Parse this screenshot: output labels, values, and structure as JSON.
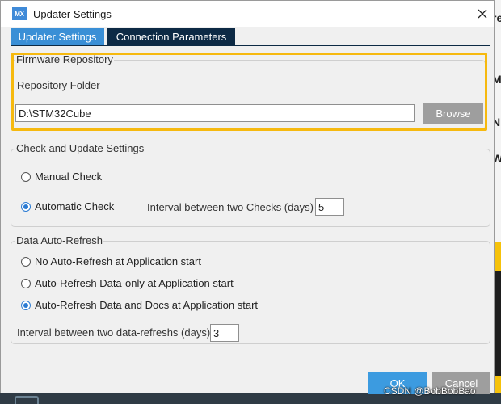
{
  "window": {
    "app_icon_text": "MX",
    "title": "Updater Settings",
    "close_glyph": "✕"
  },
  "tabs": [
    {
      "label": "Updater Settings",
      "active": true
    },
    {
      "label": "Connection Parameters",
      "active": false
    }
  ],
  "firmware_repository": {
    "legend": "Firmware Repository",
    "folder_label": "Repository Folder",
    "folder_value": "D:\\STM32Cube",
    "browse_label": "Browse",
    "highlight_color": "#f6b90f"
  },
  "check_update": {
    "legend": "Check and Update Settings",
    "manual_label": "Manual Check",
    "manual_checked": false,
    "automatic_label": "Automatic Check",
    "automatic_checked": true,
    "interval_label": "Interval between two Checks (days)",
    "interval_value": "5"
  },
  "data_refresh": {
    "legend": "Data Auto-Refresh",
    "options": [
      {
        "label": "No Auto-Refresh at Application start",
        "checked": false
      },
      {
        "label": "Auto-Refresh Data-only at Application start",
        "checked": false
      },
      {
        "label": "Auto-Refresh Data and Docs at Application start",
        "checked": true
      }
    ],
    "interval_label": "Interval between two data-refreshs (days)",
    "interval_value": "3"
  },
  "footer": {
    "ok_label": "OK",
    "cancel_label": "Cancel"
  },
  "background": {
    "glyphs": [
      "re",
      "M",
      "N",
      "W"
    ]
  },
  "watermark": "CSDN @BobBobBao",
  "colors": {
    "accent": "#3a8fd6",
    "tab_inactive": "#0d2a45",
    "highlight": "#f6b90f"
  }
}
